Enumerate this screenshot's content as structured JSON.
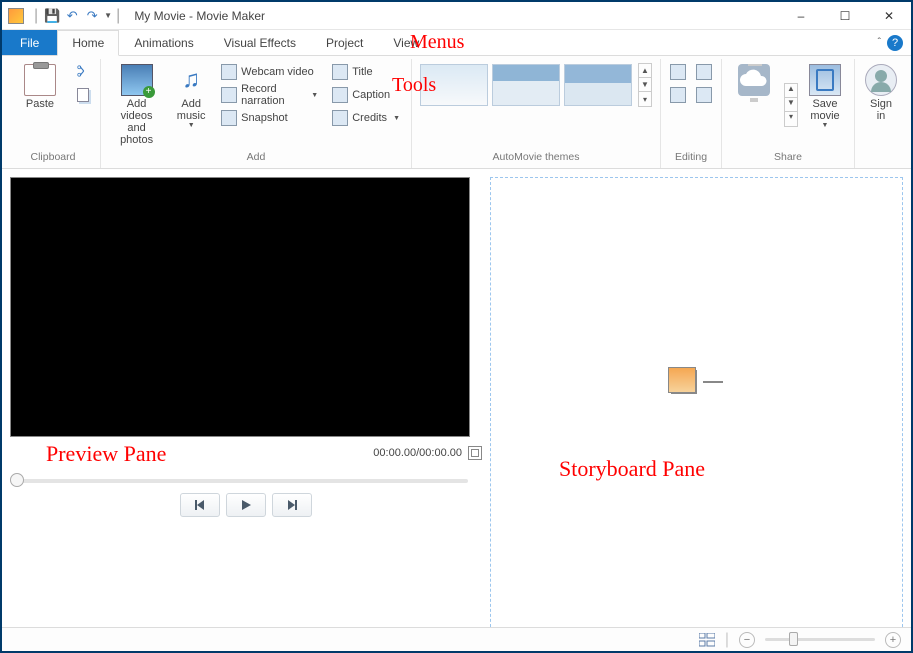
{
  "title": "My Movie - Movie Maker",
  "qat": {
    "save_tip": "Save",
    "undo_tip": "Undo",
    "redo_tip": "Redo"
  },
  "window": {
    "min": "–",
    "max": "☐",
    "close": "✕"
  },
  "menus": {
    "file": "File",
    "items": [
      "Home",
      "Animations",
      "Visual Effects",
      "Project",
      "View"
    ],
    "active_index": 0
  },
  "ribbon": {
    "clipboard": {
      "label": "Clipboard",
      "paste": "Paste",
      "cut_tip": "Cut",
      "copy_tip": "Copy"
    },
    "add": {
      "label": "Add",
      "add_videos": "Add videos\nand photos",
      "add_music": "Add\nmusic",
      "webcam": "Webcam video",
      "narration": "Record narration",
      "snapshot": "Snapshot",
      "title": "Title",
      "caption": "Caption",
      "credits": "Credits"
    },
    "themes": {
      "label": "AutoMovie themes"
    },
    "editing": {
      "label": "Editing",
      "rotate_left_tip": "Rotate left",
      "rotate_right_tip": "Rotate right",
      "remove_tip": "Remove",
      "select_all_tip": "Select all"
    },
    "share": {
      "label": "Share",
      "cloud_tip": "Publish",
      "save_movie": "Save\nmovie"
    },
    "signin": "Sign\nin"
  },
  "preview": {
    "timecode": "00:00.00/00:00.00",
    "prev_tip": "Previous frame",
    "play_tip": "Play",
    "next_tip": "Next frame",
    "fullscreen_tip": "Full screen"
  },
  "status": {
    "thumb_view_tip": "Thumbnail size",
    "zoom_out": "−",
    "zoom_in": "+"
  },
  "annotations": {
    "menus": "Menus",
    "tools": "Tools",
    "preview": "Preview Pane",
    "storyboard": "Storyboard Pane"
  }
}
